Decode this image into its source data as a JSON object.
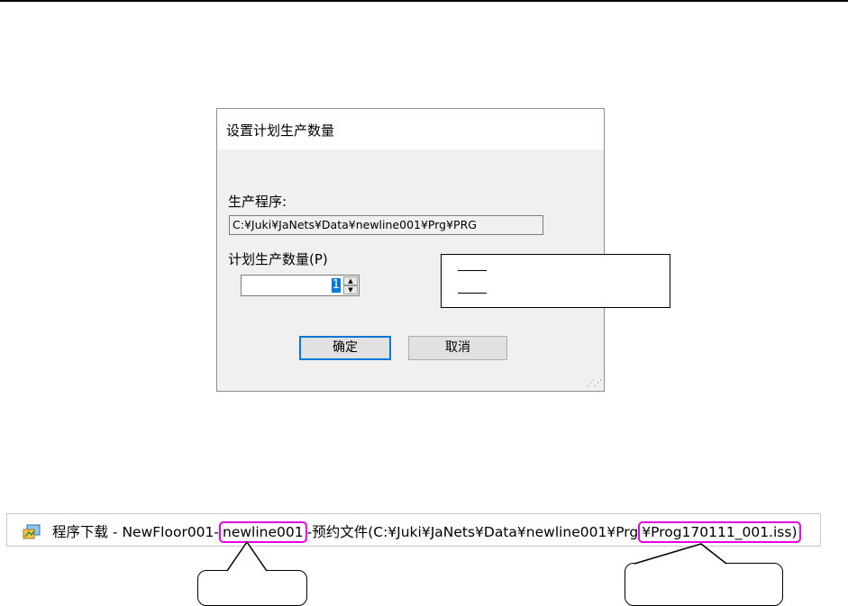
{
  "dialog": {
    "title": "设置计划生产数量",
    "program_label": "生产程序:",
    "program_path": "C:¥Juki¥JaNets¥Data¥newline001¥Prg¥PRG",
    "quantity_label": "计划生产数量(P)",
    "quantity_value": "1",
    "ok_label": "确定",
    "cancel_label": "取消"
  },
  "window_title": {
    "prefix": "程序下载 - NewFloor001-",
    "line_name": "newline001",
    "middle": "-预约文件(C:¥Juki¥JaNets¥Data¥newline001¥Prg",
    "file_name": "¥Prog170111_001.iss)"
  },
  "colors": {
    "highlight": "#e600e6",
    "accent": "#0078d7",
    "dialog_bg": "#f0f0f0"
  },
  "icons": {
    "app_icon": "program-download-icon",
    "spin_up": "spinner-up-icon",
    "spin_down": "spinner-down-icon",
    "resize": "resize-grip-icon"
  }
}
